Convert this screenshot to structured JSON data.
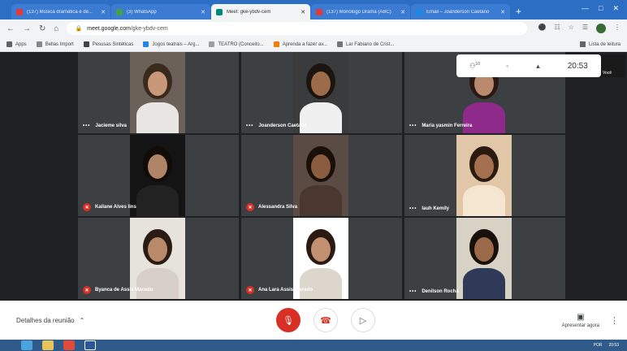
{
  "browser": {
    "tabs": [
      {
        "title": "(137) Música dramática e de...",
        "favicon_color": "#e53935",
        "active": false
      },
      {
        "title": "(3) WhatsApp",
        "favicon_color": "#43a047",
        "active": false
      },
      {
        "title": "Meet: gke-ybdv-cem",
        "favicon_color": "#00897b",
        "active": true
      },
      {
        "title": "(137) Monólogo Drama (ABC)",
        "favicon_color": "#e53935",
        "active": false
      },
      {
        "title": "Email – Joanderson Caetano",
        "favicon_color": "#1e88e5",
        "active": false
      }
    ],
    "new_tab": "+",
    "url_host": "meet.google.com",
    "url_path": "/gke-ybdv-cem",
    "bookmarks": [
      {
        "label": "Apps",
        "color": "#5f6368"
      },
      {
        "label": "Bellas Import",
        "color": "#888888"
      },
      {
        "label": "Pesusas Sintéticas",
        "color": "#444444"
      },
      {
        "label": "Jogos teatrais – Arg...",
        "color": "#1e88e5"
      },
      {
        "label": "TEATRO (Conceito...",
        "color": "#9e9e9e"
      },
      {
        "label": "Aprenda a fazer av...",
        "color": "#f57c00"
      },
      {
        "label": "Lar Fabiano de Crist...",
        "color": "#757575"
      }
    ],
    "reading_list": "Lista de leitura"
  },
  "meeting": {
    "clock": "20:53",
    "self_label": "Você",
    "participants": [
      {
        "name": "Jacieme silva",
        "muted": false,
        "skin": "#c89878",
        "hair": "#3a2a1e",
        "shirt": "#e8e6e2",
        "bg": "#6b6158"
      },
      {
        "name": "Joanderson Caetano",
        "muted": false,
        "skin": "#9c6b48",
        "hair": "#1c140e",
        "shirt": "#f0f0f0",
        "bg": "#3a3b3d"
      },
      {
        "name": "Maria yasmin Ferreira",
        "muted": false,
        "skin": "#b98a6e",
        "hair": "#2b1a14",
        "shirt": "#8e2a8a",
        "bg": "#3c4043"
      },
      {
        "name": "Kailane Alves lins",
        "muted": true,
        "skin": "#b08466",
        "hair": "#120c08",
        "shirt": "#222222",
        "bg": "#141414"
      },
      {
        "name": "Alessandra Silva",
        "muted": true,
        "skin": "#8a5c40",
        "hair": "#1a100a",
        "shirt": "#4a3830",
        "bg": "#5a4c44"
      },
      {
        "name": "lauh Kemily",
        "muted": false,
        "skin": "#a57050",
        "hair": "#2a1a10",
        "shirt": "#f4e6d0",
        "bg": "#e2c6a8"
      },
      {
        "name": "Byanca de Assis Macedo",
        "muted": true,
        "skin": "#b88a6a",
        "hair": "#2a1c14",
        "shirt": "#d8d0c8",
        "bg": "#e6e2dc"
      },
      {
        "name": "Ana Lara Assis Macedo",
        "muted": true,
        "skin": "#c09070",
        "hair": "#2a1a12",
        "shirt": "#ddd6cc",
        "bg": "#ffffff"
      },
      {
        "name": "Denilson Rocha",
        "muted": false,
        "skin": "#9a6a4a",
        "hair": "#18100a",
        "shirt": "#2e3a58",
        "bg": "#d8d2c4"
      }
    ]
  },
  "bottom": {
    "details_label": "Detalhes da reunião",
    "present_label": "Apresentar agora"
  },
  "taskbar": {
    "lang": "POR",
    "time": "20:53"
  }
}
